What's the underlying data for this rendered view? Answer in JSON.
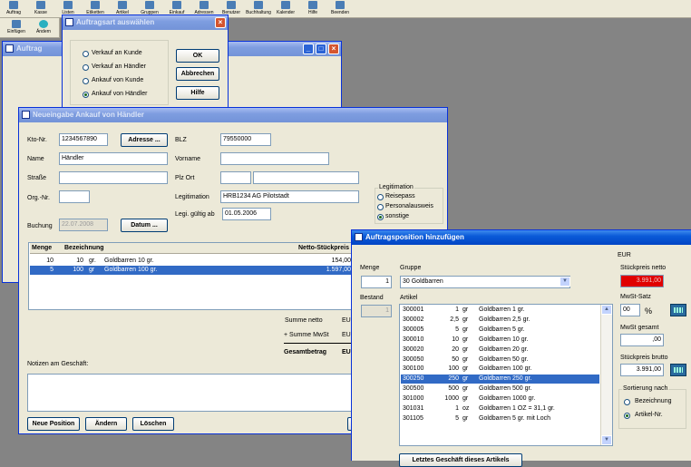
{
  "toolbar": {
    "buttons": [
      "Auftrag",
      "Kasse",
      "Listen",
      "Etiketten",
      "Artikel",
      "Gruppen",
      "Einkauf",
      "Adressen",
      "Benutzer",
      "Buchhaltung",
      "Kalender",
      "Hilfe",
      "Beenden"
    ],
    "secondary": [
      "Einfügen",
      "Ändern"
    ]
  },
  "auftragsart_dialog": {
    "title": "Auftragsart auswählen",
    "options": [
      "Verkauf an Kunde",
      "Verkauf an Händler",
      "Ankauf von Kunde",
      "Ankauf von Händler"
    ],
    "selected_index": 3,
    "ok": "OK",
    "abbrechen": "Abbrechen",
    "hilfe": "Hilfe"
  },
  "auftrag_window": {
    "title": "Auftrag"
  },
  "neueingabe": {
    "title": "Neueingabe Ankauf von Händler",
    "kto_label": "Kto-Nr.",
    "kto_value": "1234567890",
    "adresse_button": "Adresse ...",
    "blz_label": "BLZ",
    "blz_value": "79550000",
    "name_label": "Name",
    "name_value": "Händler",
    "vorname_label": "Vorname",
    "vorname_value": "",
    "strasse_label": "Straße",
    "plzort_label": "Plz Ort",
    "orgnr_label": "Org.-Nr.",
    "legitimation_label": "Legitimation",
    "legitimation_value": "HRB1234 AG Pilotstadt",
    "gueltig_label": "Legi. gültig ab",
    "gueltig_value": "01.05.2006",
    "buchung_label": "Buchung",
    "buchung_value": "22.07.2008",
    "datum_button": "Datum ...",
    "legit_group_title": "Legitimation",
    "legit_options": [
      "Reisepass",
      "Personalausweis",
      "sonstige"
    ],
    "legit_selected": 2,
    "table_headers": {
      "menge": "Menge",
      "bezeichnung": "Bezeichnung",
      "netto": "Netto-Stückpreis"
    },
    "rows": [
      {
        "menge": "10",
        "gew": "10",
        "unit": "gr.",
        "text": "Goldbarren 10 gr.",
        "netto": "154,00"
      },
      {
        "menge": "5",
        "gew": "100",
        "unit": "gr",
        "text": "Goldbarren 100 gr.",
        "netto": "1.597,00"
      }
    ],
    "selected_row": 1,
    "summe_netto": "Summe netto",
    "summe_mwst": "+ Summe MwSt",
    "gesamtbetrag": "Gesamtbetrag",
    "currency_cut": "EU",
    "notizen_label": "Notizen am Geschäft:",
    "neue_position": "Neue Position",
    "aendern": "Ändern",
    "loeschen": "Löschen"
  },
  "position_dialog": {
    "title": "Auftragsposition hinzufügen",
    "menge_label": "Menge",
    "menge_value": "1",
    "gruppe_label": "Gruppe",
    "gruppe_value": "30  Goldbarren",
    "bestand_label": "Bestand",
    "bestand_value": "1",
    "artikel_label": "Artikel",
    "articles": [
      {
        "nr": "300001",
        "qty": "1",
        "unit": "gr",
        "name": "Goldbarren 1 gr."
      },
      {
        "nr": "300002",
        "qty": "2,5",
        "unit": "gr",
        "name": "Goldbarren 2,5 gr."
      },
      {
        "nr": "300005",
        "qty": "5",
        "unit": "gr",
        "name": "Goldbarren 5 gr."
      },
      {
        "nr": "300010",
        "qty": "10",
        "unit": "gr",
        "name": "Goldbarren 10 gr."
      },
      {
        "nr": "300020",
        "qty": "20",
        "unit": "gr",
        "name": "Goldbarren 20 gr."
      },
      {
        "nr": "300050",
        "qty": "50",
        "unit": "gr",
        "name": "Goldbarren 50 gr."
      },
      {
        "nr": "300100",
        "qty": "100",
        "unit": "gr",
        "name": "Goldbarren 100 gr."
      },
      {
        "nr": "300250",
        "qty": "250",
        "unit": "gr",
        "name": "Goldbarren 250 gr."
      },
      {
        "nr": "300500",
        "qty": "500",
        "unit": "gr",
        "name": "Goldbarren 500 gr."
      },
      {
        "nr": "301000",
        "qty": "1000",
        "unit": "gr",
        "name": "Goldbarren 1000 gr."
      },
      {
        "nr": "301031",
        "qty": "1",
        "unit": "oz",
        "name": "Goldbarren 1 OZ = 31,1 gr."
      },
      {
        "nr": "301105",
        "qty": "5",
        "unit": "gr",
        "name": "Goldbarren 5 gr. mit Loch"
      }
    ],
    "selected_article": 7,
    "eur_label": "EUR",
    "netto_label": "Stückpreis netto",
    "netto_value": "3.991,00",
    "mwst_satz_label": "MwSt-Satz",
    "mwst_satz_value": "00",
    "percent": "%",
    "mwst_gesamt_label": "MwSt gesamt",
    "mwst_gesamt_value": ",00",
    "brutto_label": "Stückpreis brutto",
    "brutto_value": "3.991,00",
    "sortierung_label": "Sortierung nach",
    "sort_options": [
      "Bezeichnung",
      "Artikel-Nr."
    ],
    "sort_selected": 1,
    "letztes_geschaeft": "Letztes Geschäft dieses Artikels"
  },
  "colors": {
    "accent": "#0a5ad8",
    "selection": "#316ac5",
    "price_red": "#e00000"
  }
}
